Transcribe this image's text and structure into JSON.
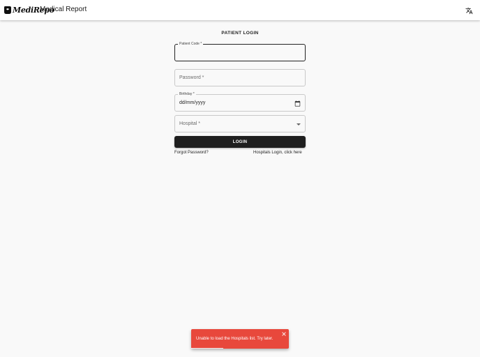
{
  "app": {
    "logo_text": "MediRepo",
    "title": "Medical Report",
    "translate_icon": "translate-icon"
  },
  "login": {
    "heading": "PATIENT LOGIN",
    "patient_code": {
      "label": "Patient Code *",
      "value": ""
    },
    "password": {
      "label": "Password *",
      "value": ""
    },
    "birthday": {
      "label": "Birthday *",
      "value": "dd/mm/yyyy"
    },
    "hospital": {
      "label": "Hospital *",
      "value": ""
    },
    "login_button": "LOGIN",
    "forgot_password": "Forgot Password?",
    "hospitals_login": "Hospitals Login, click here"
  },
  "snackbar": {
    "message": "Unable to load the Hospitals list. Try later.",
    "close_icon": "close-icon",
    "progress": 0.33,
    "color": "#e8483c"
  },
  "colors": {
    "background": "#f9f9f9",
    "appbar": "#ffffff",
    "primary_button": "#1f1f1f"
  }
}
